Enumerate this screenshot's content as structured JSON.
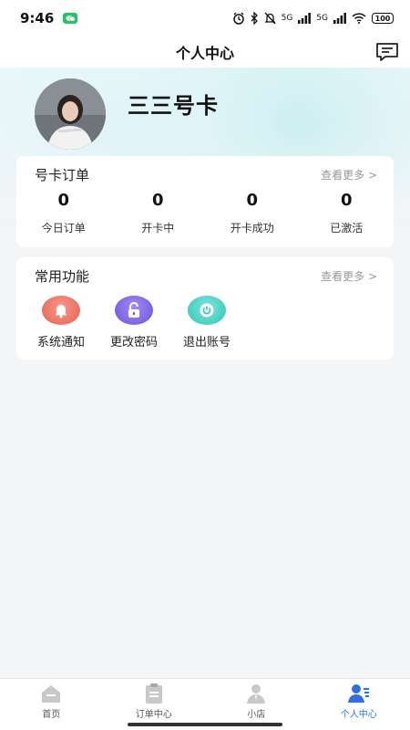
{
  "status_bar": {
    "time": "9:46",
    "network_label_1": "5G",
    "network_label_2": "5G",
    "battery": "100"
  },
  "header": {
    "title": "个人中心",
    "message_icon": "message-icon"
  },
  "profile": {
    "name": "三三号卡"
  },
  "orders_card": {
    "title": "号卡订单",
    "more": "查看更多 >",
    "stats": [
      {
        "value": "0",
        "label": "今日订单"
      },
      {
        "value": "0",
        "label": "开卡中"
      },
      {
        "value": "0",
        "label": "开卡成功"
      },
      {
        "value": "0",
        "label": "已激活"
      }
    ]
  },
  "functions_card": {
    "title": "常用功能",
    "more": "查看更多 >",
    "items": [
      {
        "label": "系统通知",
        "icon": "bell-icon",
        "color": "#ef6b5b"
      },
      {
        "label": "更改密码",
        "icon": "lock-icon",
        "color": "#7f67e6"
      },
      {
        "label": "退出账号",
        "icon": "power-icon",
        "color": "#3fd1c5"
      }
    ]
  },
  "tab_bar": {
    "tabs": [
      {
        "label": "首页",
        "icon": "home-icon",
        "active": false
      },
      {
        "label": "订单中心",
        "icon": "clipboard-icon",
        "active": false
      },
      {
        "label": "小店",
        "icon": "shop-icon",
        "active": false
      },
      {
        "label": "个人中心",
        "icon": "person-icon",
        "active": true
      }
    ],
    "active_color": "#2f6fe0"
  }
}
